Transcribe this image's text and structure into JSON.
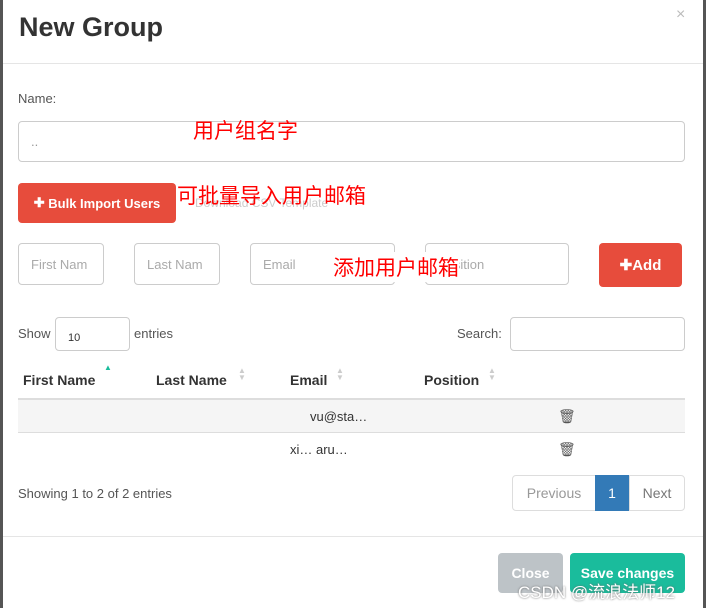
{
  "modal": {
    "title": "New Group",
    "close": "×"
  },
  "form": {
    "name_label": "Name:",
    "name_value": "..",
    "bulk_button": "Bulk Import Users",
    "download_link": "Download CSV Template",
    "first_placeholder": "First Nam",
    "last_placeholder": "Last Nam",
    "email_placeholder": "Email",
    "position_placeholder": "Position",
    "add_button": "Add"
  },
  "annotations": {
    "group_name": "用户组名字",
    "bulk": "可批量导入用户邮箱",
    "add": "添加用户邮箱"
  },
  "table": {
    "show": "Show",
    "entries_value": "10",
    "entries": "entries",
    "search_label": "Search:",
    "headers": [
      "First Name",
      "Last Name",
      "Email",
      "Position"
    ],
    "rows": [
      {
        "email": "vu@sta…"
      },
      {
        "email": "xi… aru…"
      }
    ],
    "info": "Showing 1 to 2 of 2 entries",
    "prev": "Previous",
    "page": "1",
    "next": "Next"
  },
  "footer": {
    "close": "Close",
    "save": "Save changes"
  },
  "watermark": "CSDN @流浪法师12",
  "colors": {
    "danger": "#e74c3c",
    "success": "#1abc9c",
    "primary": "#337ab7"
  }
}
